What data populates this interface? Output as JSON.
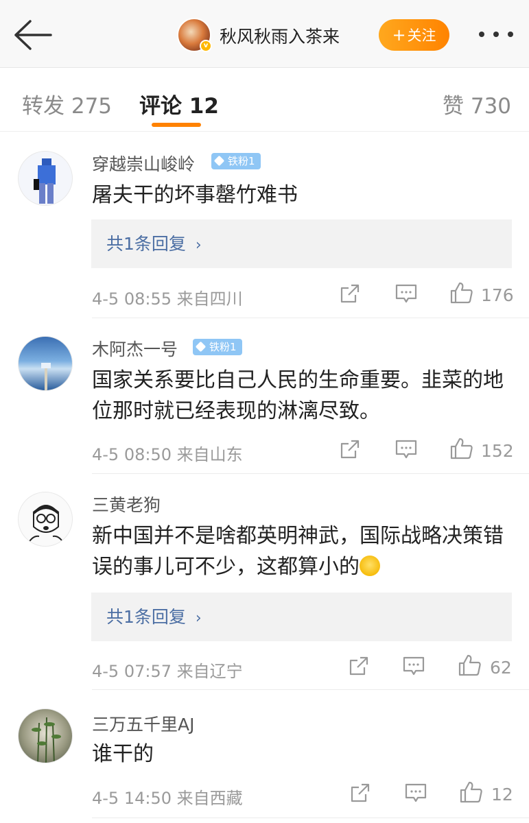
{
  "header": {
    "author_name": "秋风秋雨入茶来",
    "follow_label": "关注",
    "follow_plus": "+"
  },
  "tabs": [
    {
      "label": "转发 275"
    },
    {
      "label": "评论 12"
    },
    {
      "label": "赞 730"
    }
  ],
  "comments": [
    {
      "name": "穿越崇山峻岭",
      "badge": "铁粉1",
      "text": "屠夫干的坏事罄竹难书",
      "reply_label": "共1条回复",
      "time_location": "4-5 08:55  来自四川",
      "likes": "176"
    },
    {
      "name": "木阿杰一号",
      "badge": "铁粉1",
      "text": "国家关系要比自己人民的生命重要。韭菜的地位那时就已经表现的淋漓尽致。",
      "time_location": "4-5 08:50  来自山东",
      "likes": "152"
    },
    {
      "name": "三黄老狗",
      "text": "新中国并不是啥都英明神武，国际战略决策错误的事儿可不少，这都算小的",
      "reply_label": "共1条回复",
      "time_location": "4-5 07:57  来自辽宁",
      "likes": "62"
    },
    {
      "name": "三万五千里AJ",
      "text": "谁干的",
      "time_location": "4-5 14:50  来自西藏",
      "likes": "12"
    }
  ],
  "colors": {
    "accent": "#ff8200",
    "link": "#4b6ea3",
    "badge": "#8fc6f5"
  }
}
